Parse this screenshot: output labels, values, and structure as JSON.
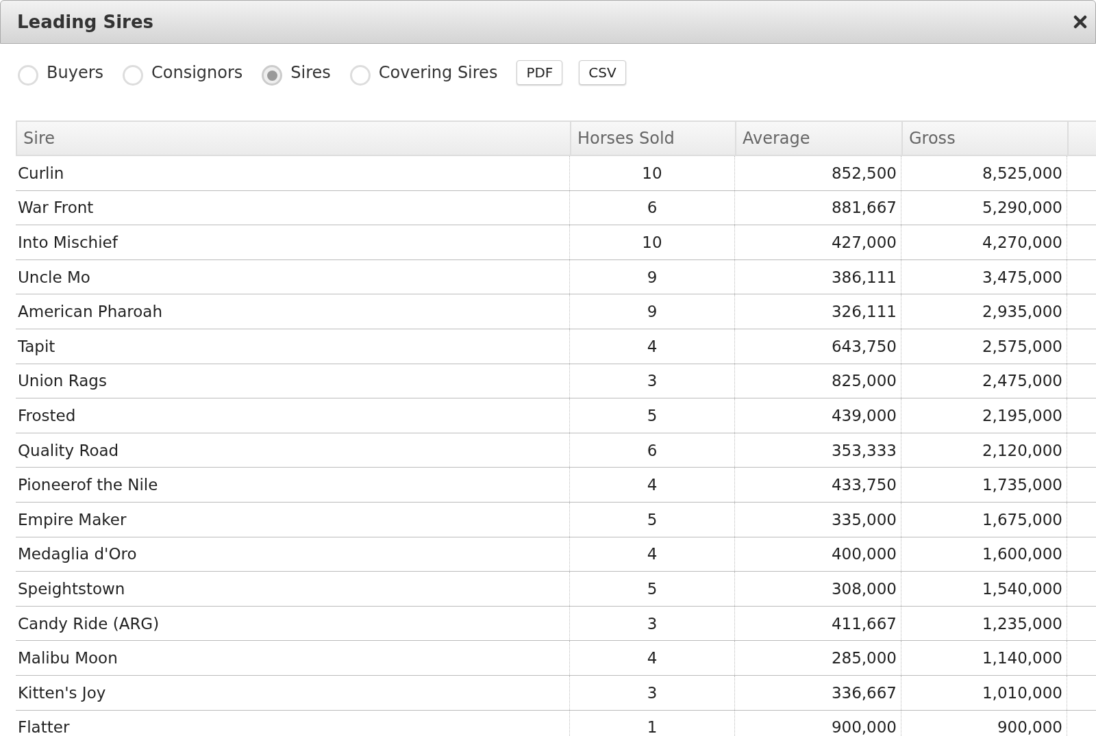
{
  "window": {
    "title": "Leading Sires"
  },
  "options": [
    {
      "label": "Buyers",
      "selected": false
    },
    {
      "label": "Consignors",
      "selected": false
    },
    {
      "label": "Sires",
      "selected": true
    },
    {
      "label": "Covering Sires",
      "selected": false
    }
  ],
  "buttons": [
    "PDF",
    "CSV"
  ],
  "table": {
    "columns": [
      "Sire",
      "Horses Sold",
      "Average",
      "Gross"
    ],
    "rows": [
      [
        "Curlin",
        "10",
        "852,500",
        "8,525,000"
      ],
      [
        "War Front",
        "6",
        "881,667",
        "5,290,000"
      ],
      [
        "Into Mischief",
        "10",
        "427,000",
        "4,270,000"
      ],
      [
        "Uncle Mo",
        "9",
        "386,111",
        "3,475,000"
      ],
      [
        "American Pharoah",
        "9",
        "326,111",
        "2,935,000"
      ],
      [
        "Tapit",
        "4",
        "643,750",
        "2,575,000"
      ],
      [
        "Union Rags",
        "3",
        "825,000",
        "2,475,000"
      ],
      [
        "Frosted",
        "5",
        "439,000",
        "2,195,000"
      ],
      [
        "Quality Road",
        "6",
        "353,333",
        "2,120,000"
      ],
      [
        "Pioneerof the Nile",
        "4",
        "433,750",
        "1,735,000"
      ],
      [
        "Empire Maker",
        "5",
        "335,000",
        "1,675,000"
      ],
      [
        "Medaglia d'Oro",
        "4",
        "400,000",
        "1,600,000"
      ],
      [
        "Speightstown",
        "5",
        "308,000",
        "1,540,000"
      ],
      [
        "Candy Ride (ARG)",
        "3",
        "411,667",
        "1,235,000"
      ],
      [
        "Malibu Moon",
        "4",
        "285,000",
        "1,140,000"
      ],
      [
        "Kitten's Joy",
        "3",
        "336,667",
        "1,010,000"
      ],
      [
        "Flatter",
        "1",
        "900,000",
        "900,000"
      ]
    ]
  }
}
